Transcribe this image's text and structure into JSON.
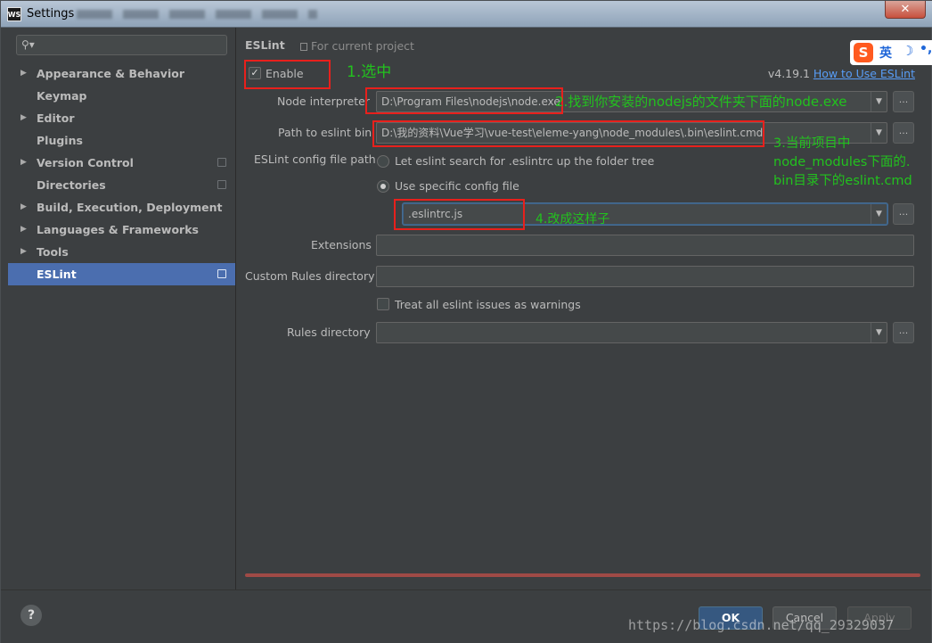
{
  "window": {
    "title": "Settings",
    "app_icon": "WS",
    "close_glyph": "✕"
  },
  "sidebar": {
    "search_placeholder": "",
    "items": [
      {
        "label": "Appearance & Behavior",
        "expandable": true
      },
      {
        "label": "Keymap",
        "expandable": false
      },
      {
        "label": "Editor",
        "expandable": true
      },
      {
        "label": "Plugins",
        "expandable": false
      },
      {
        "label": "Version Control",
        "expandable": true
      },
      {
        "label": "Directories",
        "expandable": false
      },
      {
        "label": "Build, Execution, Deployment",
        "expandable": true
      },
      {
        "label": "Languages & Frameworks",
        "expandable": true
      },
      {
        "label": "Tools",
        "expandable": true
      },
      {
        "label": "ESLint",
        "expandable": false,
        "selected": true
      }
    ]
  },
  "main": {
    "breadcrumb": "ESLint",
    "scope": "For current project",
    "enable_label": "Enable",
    "enable_checked": true,
    "version": "v4.19.1",
    "help_link": "How to Use ESLint",
    "node_interpreter": {
      "label": "Node interpreter",
      "value": "D:\\Program Files\\nodejs\\node.exe"
    },
    "eslint_bin": {
      "label": "Path to eslint bin",
      "value": "D:\\我的资料\\Vue学习\\vue-test\\eleme-yang\\node_modules\\.bin\\eslint.cmd"
    },
    "config_file": {
      "label": "ESLint config file path",
      "option_search": "Let eslint search for .eslintrc up the folder tree",
      "option_specific": "Use specific config file",
      "value": ".eslintrc.js"
    },
    "extensions_label": "Extensions",
    "custom_rules_label": "Custom Rules directory",
    "treat_warnings_label": "Treat all eslint issues as warnings",
    "rules_directory_label": "Rules directory",
    "browse_glyph": "..."
  },
  "annotations": {
    "step1": "1.选中",
    "step2": "2.找到你安装的nodejs的文件夹下面的node.exe",
    "step3_line1": "3.当前项目中",
    "step3_line2": "node_modules下面的.",
    "step3_line3": "bin目录下的eslint.cmd",
    "step4": "4.改成这样子"
  },
  "footer": {
    "help_glyph": "?",
    "ok": "OK",
    "cancel": "Cancel",
    "apply": "Apply"
  },
  "watermark": "https://blog.csdn.net/qq_29329037",
  "ime": {
    "logo": "S",
    "lang": "英",
    "moon": "☽",
    "dot": "•,"
  },
  "colors": {
    "accent_selected": "#4b6eaf",
    "annotation_green": "#22c21e",
    "annotation_red": "#e8201c",
    "link": "#589df6"
  }
}
